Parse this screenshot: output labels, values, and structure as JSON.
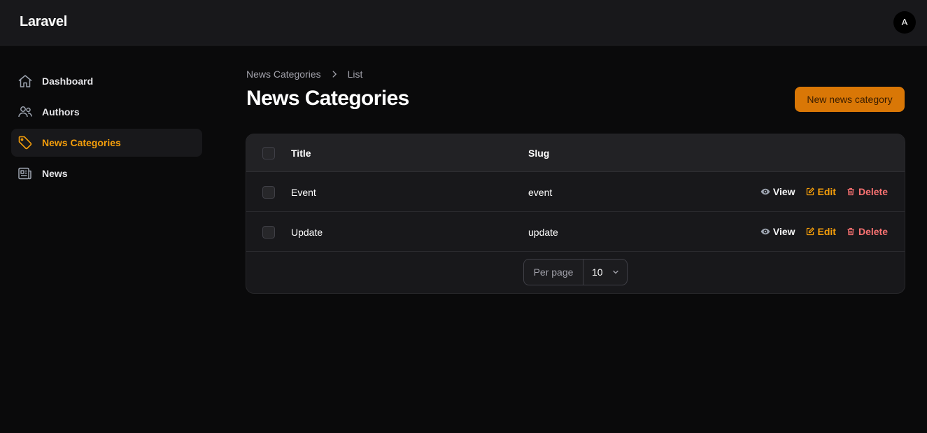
{
  "app": {
    "brand": "Laravel",
    "user_initial": "A"
  },
  "sidebar": {
    "items": [
      {
        "label": "Dashboard",
        "icon": "home-icon",
        "active": false
      },
      {
        "label": "Authors",
        "icon": "users-icon",
        "active": false
      },
      {
        "label": "News Categories",
        "icon": "tag-icon",
        "active": true
      },
      {
        "label": "News",
        "icon": "newspaper-icon",
        "active": false
      }
    ]
  },
  "breadcrumb": {
    "parent": "News Categories",
    "current": "List"
  },
  "page": {
    "title": "News Categories",
    "new_button": "New news category"
  },
  "table": {
    "columns": {
      "title": "Title",
      "slug": "Slug"
    },
    "rows": [
      {
        "title": "Event",
        "slug": "event"
      },
      {
        "title": "Update",
        "slug": "update"
      }
    ],
    "actions": {
      "view": "View",
      "edit": "Edit",
      "delete": "Delete"
    }
  },
  "pagination": {
    "per_page_label": "Per page",
    "per_page_value": "10"
  },
  "colors": {
    "accent": "#f59e0b",
    "primary_button": "#d97706",
    "danger": "#f87171",
    "background": "#0a0a0b"
  }
}
